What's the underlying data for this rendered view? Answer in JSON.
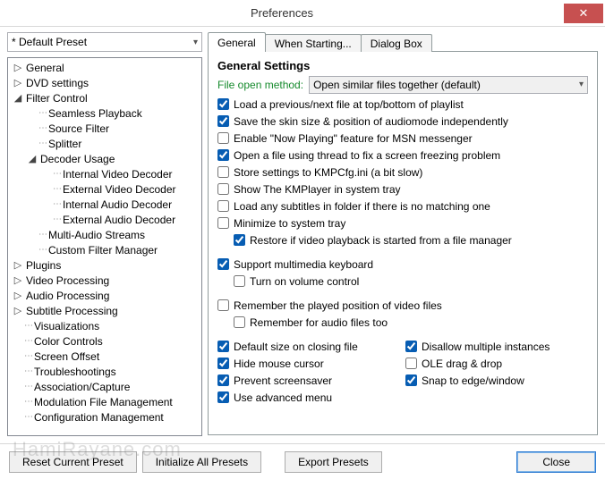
{
  "window": {
    "title": "Preferences"
  },
  "preset": {
    "selected": "* Default Preset"
  },
  "close_glyph": "✕",
  "tree": [
    {
      "label": "General",
      "depth": 1,
      "twisty": "▷"
    },
    {
      "label": "DVD settings",
      "depth": 1,
      "twisty": "▷"
    },
    {
      "label": "Filter Control",
      "depth": 1,
      "twisty": "◢"
    },
    {
      "label": "Seamless Playback",
      "depth": 2,
      "twisty": ""
    },
    {
      "label": "Source Filter",
      "depth": 2,
      "twisty": ""
    },
    {
      "label": "Splitter",
      "depth": 2,
      "twisty": ""
    },
    {
      "label": "Decoder Usage",
      "depth": 2,
      "twisty": "◢"
    },
    {
      "label": "Internal Video Decoder",
      "depth": 3,
      "twisty": ""
    },
    {
      "label": "External Video Decoder",
      "depth": 3,
      "twisty": ""
    },
    {
      "label": "Internal Audio Decoder",
      "depth": 3,
      "twisty": ""
    },
    {
      "label": "External Audio Decoder",
      "depth": 3,
      "twisty": ""
    },
    {
      "label": "Multi-Audio Streams",
      "depth": 2,
      "twisty": ""
    },
    {
      "label": "Custom Filter Manager",
      "depth": 2,
      "twisty": ""
    },
    {
      "label": "Plugins",
      "depth": 1,
      "twisty": "▷"
    },
    {
      "label": "Video Processing",
      "depth": 1,
      "twisty": "▷"
    },
    {
      "label": "Audio Processing",
      "depth": 1,
      "twisty": "▷"
    },
    {
      "label": "Subtitle Processing",
      "depth": 1,
      "twisty": "▷"
    },
    {
      "label": "Visualizations",
      "depth": 1,
      "twisty": ""
    },
    {
      "label": "Color Controls",
      "depth": 1,
      "twisty": ""
    },
    {
      "label": "Screen Offset",
      "depth": 1,
      "twisty": ""
    },
    {
      "label": "Troubleshootings",
      "depth": 1,
      "twisty": ""
    },
    {
      "label": "Association/Capture",
      "depth": 1,
      "twisty": ""
    },
    {
      "label": "Modulation File Management",
      "depth": 1,
      "twisty": ""
    },
    {
      "label": "Configuration Management",
      "depth": 1,
      "twisty": ""
    }
  ],
  "tabs": [
    {
      "label": "General",
      "active": true
    },
    {
      "label": "When Starting...",
      "active": false
    },
    {
      "label": "Dialog Box",
      "active": false
    }
  ],
  "panel": {
    "heading": "General Settings",
    "file_open_label": "File open method:",
    "file_open_value": "Open similar files together (default)",
    "checks": {
      "load_prev_next": {
        "label": "Load a previous/next file at top/bottom of playlist",
        "checked": true
      },
      "save_skin": {
        "label": "Save the skin size & position of audiomode independently",
        "checked": true
      },
      "enable_now_playing": {
        "label": "Enable \"Now Playing\" feature for MSN messenger",
        "checked": false
      },
      "open_thread": {
        "label": "Open a file using thread to fix a screen freezing problem",
        "checked": true
      },
      "store_kmpcfg": {
        "label": "Store settings to KMPCfg.ini (a bit slow)",
        "checked": false
      },
      "show_tray": {
        "label": "Show The KMPlayer in system tray",
        "checked": false
      },
      "load_subtitles": {
        "label": "Load any subtitles in folder if there is no matching one",
        "checked": false
      },
      "minimize_tray": {
        "label": "Minimize to system tray",
        "checked": false
      },
      "restore_playback": {
        "label": "Restore if video playback is started from a file manager",
        "checked": true
      },
      "support_mmkb": {
        "label": "Support multimedia keyboard",
        "checked": true
      },
      "turn_on_volume": {
        "label": "Turn on volume control",
        "checked": false
      },
      "remember_pos": {
        "label": "Remember the played position of video files",
        "checked": false
      },
      "remember_audio": {
        "label": "Remember for audio files too",
        "checked": false
      },
      "default_size_close": {
        "label": "Default size on closing file",
        "checked": true
      },
      "hide_cursor": {
        "label": "Hide mouse cursor",
        "checked": true
      },
      "prevent_ss": {
        "label": "Prevent screensaver",
        "checked": true
      },
      "use_adv_menu": {
        "label": "Use advanced menu",
        "checked": true
      },
      "disallow_multi": {
        "label": "Disallow multiple instances",
        "checked": true
      },
      "ole_dragdrop": {
        "label": "OLE drag & drop",
        "checked": false
      },
      "snap_edge": {
        "label": "Snap to edge/window",
        "checked": true
      }
    }
  },
  "footer": {
    "reset": "Reset Current Preset",
    "init": "Initialize All Presets",
    "export": "Export Presets",
    "close": "Close"
  },
  "watermark": "HamiRayane.com"
}
